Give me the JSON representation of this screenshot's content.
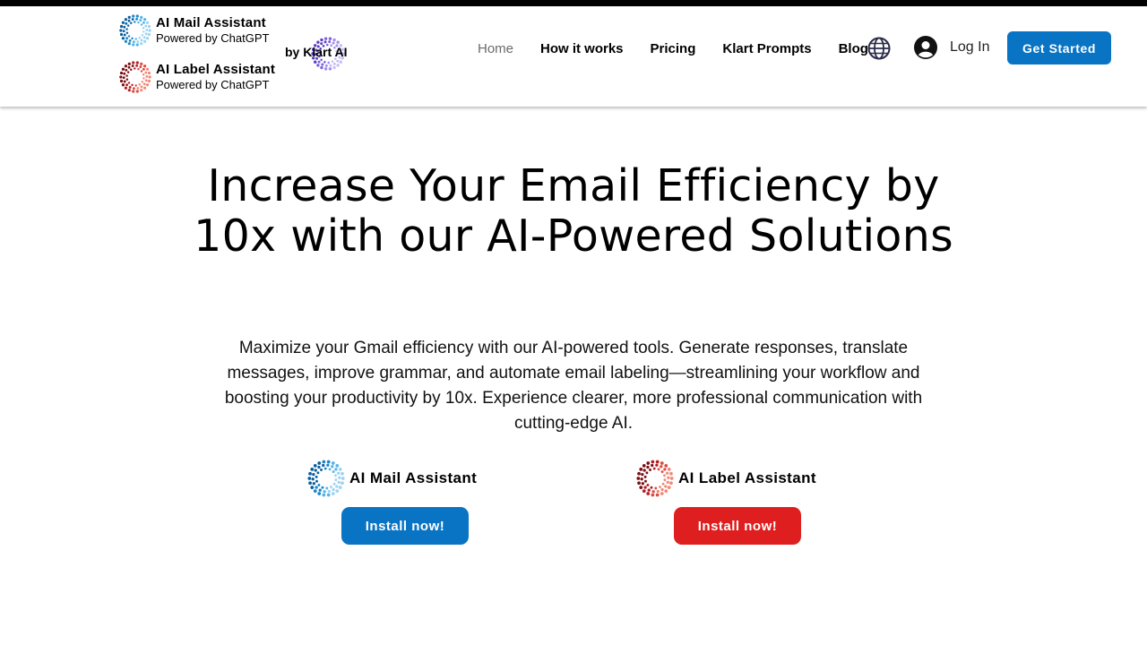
{
  "brands": {
    "mail": {
      "name": "AI Mail Assistant",
      "sub": "Powered by ChatGPT",
      "icon": "dotted-ring-blue-logo"
    },
    "label": {
      "name": "AI Label Assistant",
      "sub": "Powered by ChatGPT",
      "icon": "dotted-ring-red-logo"
    },
    "klart": {
      "text": "by Klart AI",
      "icon": "dotted-ring-purple-logo"
    }
  },
  "nav": {
    "items": [
      {
        "label": "Home",
        "active": true
      },
      {
        "label": "How it works"
      },
      {
        "label": "Pricing"
      },
      {
        "label": "Klart Prompts"
      },
      {
        "label": "Blog"
      }
    ],
    "language_icon": "globe-icon",
    "login": {
      "label": "Log In",
      "icon": "user-avatar-icon"
    },
    "cta": "Get Started"
  },
  "hero": {
    "title": "Increase Your Email Efficiency by 10x with our AI-Powered Solutions",
    "description": "Maximize your Gmail efficiency with our AI-powered tools. Generate responses, translate messages, improve grammar, and automate email labeling—streamlining your workflow and boosting your productivity by 10x. Experience clearer, more professional communication with cutting-edge AI."
  },
  "products": [
    {
      "name": "AI Mail Assistant",
      "button": "Install now!"
    },
    {
      "name": "AI Label Assistant",
      "button": "Install now!"
    }
  ],
  "colors": {
    "primary_blue": "#0a74c4",
    "primary_red": "#df1f1f",
    "klart_purple": "#7b5fe0",
    "text": "#000000",
    "nav_active": "#6b6b6b"
  }
}
